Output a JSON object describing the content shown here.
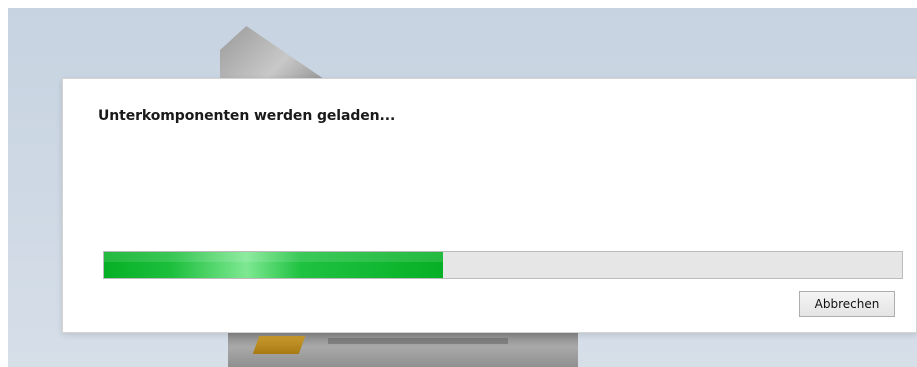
{
  "dialog": {
    "message": "Unterkomponenten werden geladen...",
    "progress_fraction": 0.425,
    "progress_color": "#06b025",
    "cancel_label": "Abbrechen"
  }
}
